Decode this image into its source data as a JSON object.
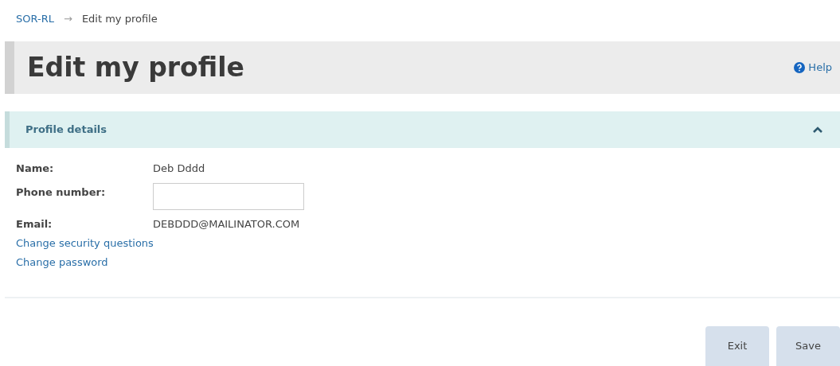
{
  "breadcrumb": [
    {
      "label": "SOR-RL",
      "kind": "link"
    },
    {
      "label": "→",
      "kind": "separator"
    },
    {
      "label": "Edit my profile",
      "kind": "current"
    }
  ],
  "page_title": "Edit my profile",
  "help_link": "Help",
  "section": {
    "title": "Profile details",
    "expanded": true,
    "fields": [
      {
        "label": "Name:",
        "kind": "text",
        "value": "Deb Dddd"
      },
      {
        "label": "Phone number:",
        "kind": "input"
      },
      {
        "label": "Email:",
        "kind": "text",
        "value": "DEBDDD@MAILINATOR.COM"
      }
    ],
    "links": [
      "Change security questions",
      "Change password"
    ]
  },
  "buttons": [
    "Exit",
    "Save"
  ]
}
